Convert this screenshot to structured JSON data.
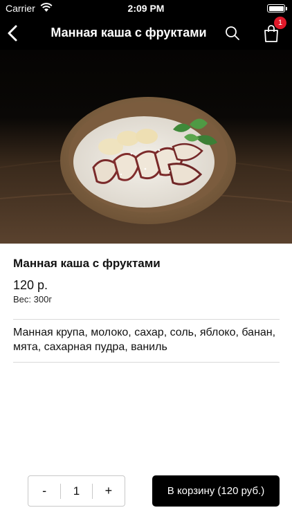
{
  "status_bar": {
    "carrier": "Carrier",
    "time": "2:09 PM"
  },
  "nav": {
    "title": "Манная каша с фруктами",
    "cart_badge": "1",
    "icons": [
      "back-chevron-icon",
      "search-icon",
      "shopping-bag-icon"
    ]
  },
  "product": {
    "name": "Манная каша с фруктами",
    "price": "120 р.",
    "weight": "Вес: 300г",
    "description": "Манная крупа, молоко, сахар, соль, яблоко, банан, мята, сахарная пудра, ваниль",
    "image_alt": ""
  },
  "order": {
    "minus_label": "-",
    "quantity": "1",
    "plus_label": "+",
    "add_to_cart_label": "В корзину (120 руб.)"
  },
  "colors": {
    "bar_background": "#000000",
    "badge": "#e0192a",
    "button_background": "#000000"
  }
}
